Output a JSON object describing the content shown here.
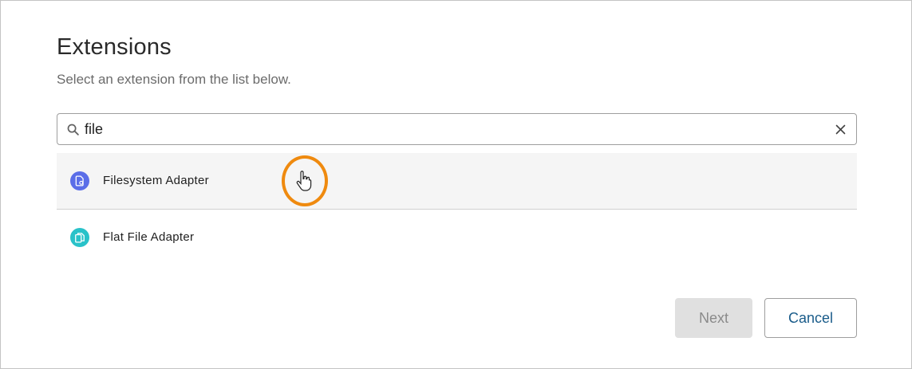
{
  "dialog": {
    "title": "Extensions",
    "subtitle": "Select an extension from the list below."
  },
  "search": {
    "value": "file",
    "search_icon": "search-icon",
    "clear_icon": "close-icon"
  },
  "results": [
    {
      "label": "Filesystem Adapter",
      "icon": "file-settings-icon",
      "icon_color": "#5b6ee8"
    },
    {
      "label": "Flat File Adapter",
      "icon": "file-copy-icon",
      "icon_color": "#29c2c9"
    }
  ],
  "buttons": {
    "next_label": "Next",
    "cancel_label": "Cancel"
  },
  "colors": {
    "cursor_highlight": "#ef8a0f",
    "cancel_text": "#1a5c8a",
    "disabled_bg": "#e0e0e0"
  }
}
